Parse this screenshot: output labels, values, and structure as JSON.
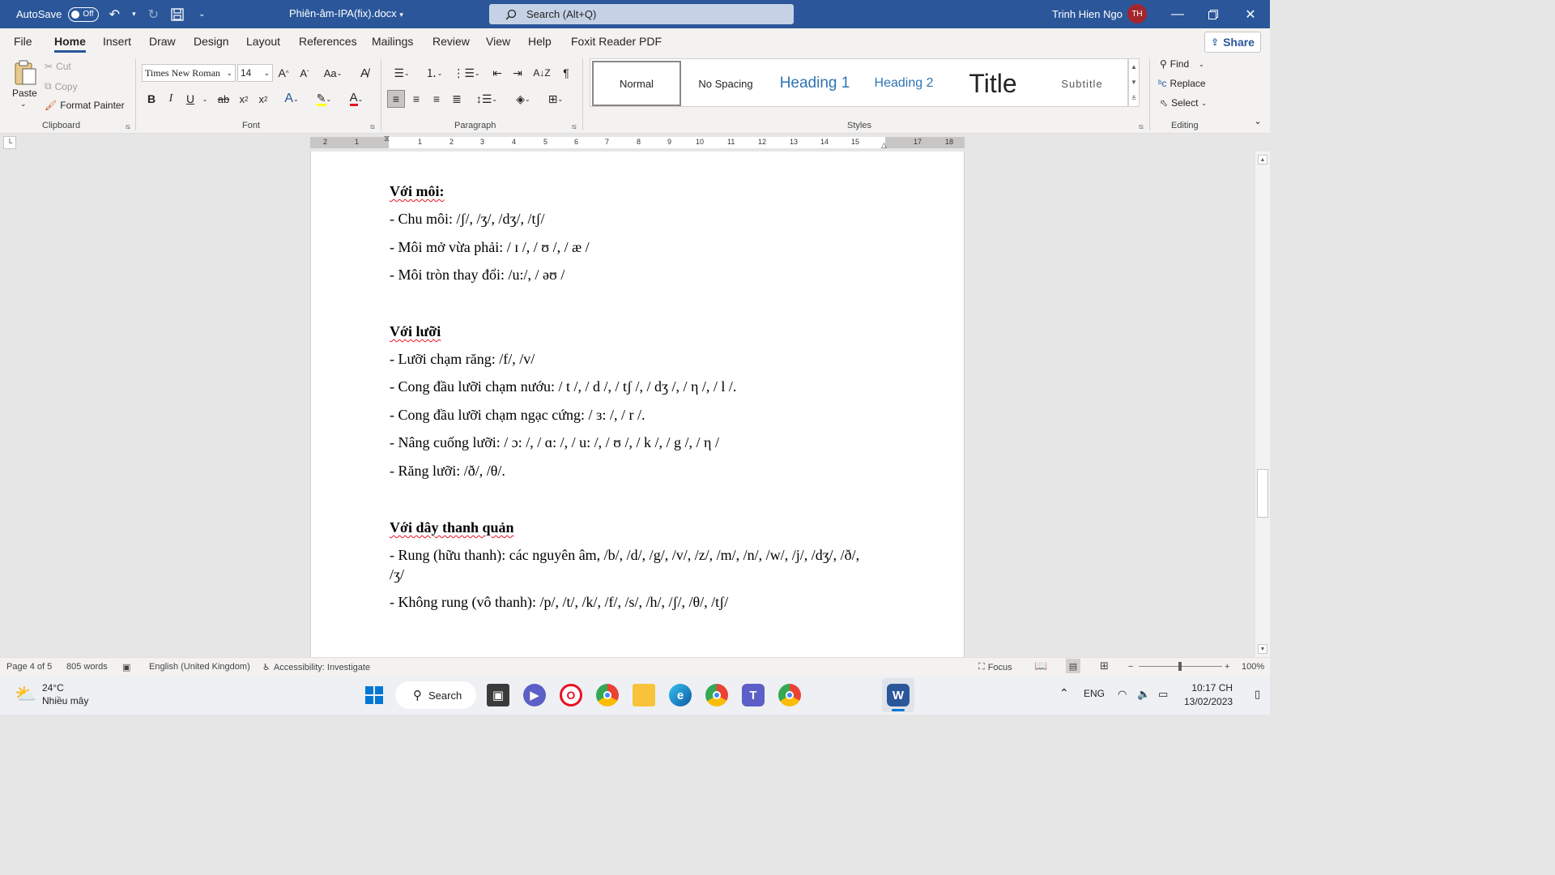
{
  "titlebar": {
    "autosave_label": "AutoSave",
    "autosave_state": "Off",
    "doc_title": "Phiên-âm-IPA(fix).docx",
    "search_placeholder": "Search (Alt+Q)",
    "user_name": "Trinh Hien Ngo",
    "user_initials": "TH"
  },
  "menu": {
    "tabs": [
      "File",
      "Home",
      "Insert",
      "Draw",
      "Design",
      "Layout",
      "References",
      "Mailings",
      "Review",
      "View",
      "Help",
      "Foxit Reader PDF"
    ],
    "active_tab": "Home",
    "share_label": "Share"
  },
  "ribbon": {
    "clipboard": {
      "paste": "Paste",
      "cut": "Cut",
      "copy": "Copy",
      "format_painter": "Format Painter",
      "label": "Clipboard"
    },
    "font": {
      "family": "Times New Roman",
      "size": "14",
      "case_label": "Aa",
      "label": "Font"
    },
    "paragraph": {
      "label": "Paragraph"
    },
    "styles": {
      "label": "Styles",
      "items": [
        "Normal",
        "No Spacing",
        "Heading 1",
        "Heading 2",
        "Title",
        "Subtitle"
      ],
      "selected": "Normal",
      "heading_color": "#2e74b5"
    },
    "editing": {
      "find": "Find",
      "replace": "Replace",
      "select": "Select",
      "label": "Editing"
    }
  },
  "ruler": {
    "ticks": [
      "2",
      "1",
      "1",
      "2",
      "3",
      "4",
      "5",
      "6",
      "7",
      "8",
      "9",
      "10",
      "11",
      "12",
      "13",
      "14",
      "15",
      "17",
      "18"
    ]
  },
  "document": {
    "heading_1": "Với môi:",
    "lines_1": [
      "- Chu môi: /ʃ/, /ʒ/, /dʒ/, /tʃ/",
      "- Môi mở vừa phải: / ɪ /, / ʊ /, / æ /",
      "- Môi tròn thay đổi: /u:/, / əʊ /"
    ],
    "heading_2": "Với lưỡi",
    "lines_2": [
      "- Lưỡi chạm răng: /f/, /v/",
      "- Cong đầu lưỡi chạm nướu: / t /, / d /, / tʃ /, / dʒ /, / η /, / l /.",
      "- Cong đầu lưỡi chạm ngạc cứng: / ɜ: /, / r /.",
      "- Nâng cuống lưỡi: / ɔ: /, / ɑ: /, / u: /, / ʊ /, / k /, / g /, / η /",
      "- Răng lưỡi: /ð/, /θ/."
    ],
    "heading_3": "Với dây thanh quản",
    "lines_3": [
      "- Rung (hữu thanh): các nguyên âm, /b/, /d/, /g/, /v/, /z/, /m/, /n/, /w/, /j/, /dʒ/, /ð/,",
      "/ʒ/",
      "- Không rung (vô thanh): /p/, /t/, /k/, /f/, /s/, /h/, /ʃ/, /θ/, /tʃ/"
    ]
  },
  "statusbar": {
    "page": "Page 4 of 5",
    "words": "805 words",
    "language": "English (United Kingdom)",
    "accessibility": "Accessibility: Investigate",
    "focus": "Focus",
    "zoom": "100%"
  },
  "taskbar": {
    "weather_temp": "24°C",
    "weather_desc": "Nhiều mây",
    "search_label": "Search",
    "lang": "ENG",
    "time": "10:17 CH",
    "date": "13/02/2023"
  },
  "colors": {
    "title_bar": "#2b579a",
    "spell_underline": "#e81123"
  }
}
